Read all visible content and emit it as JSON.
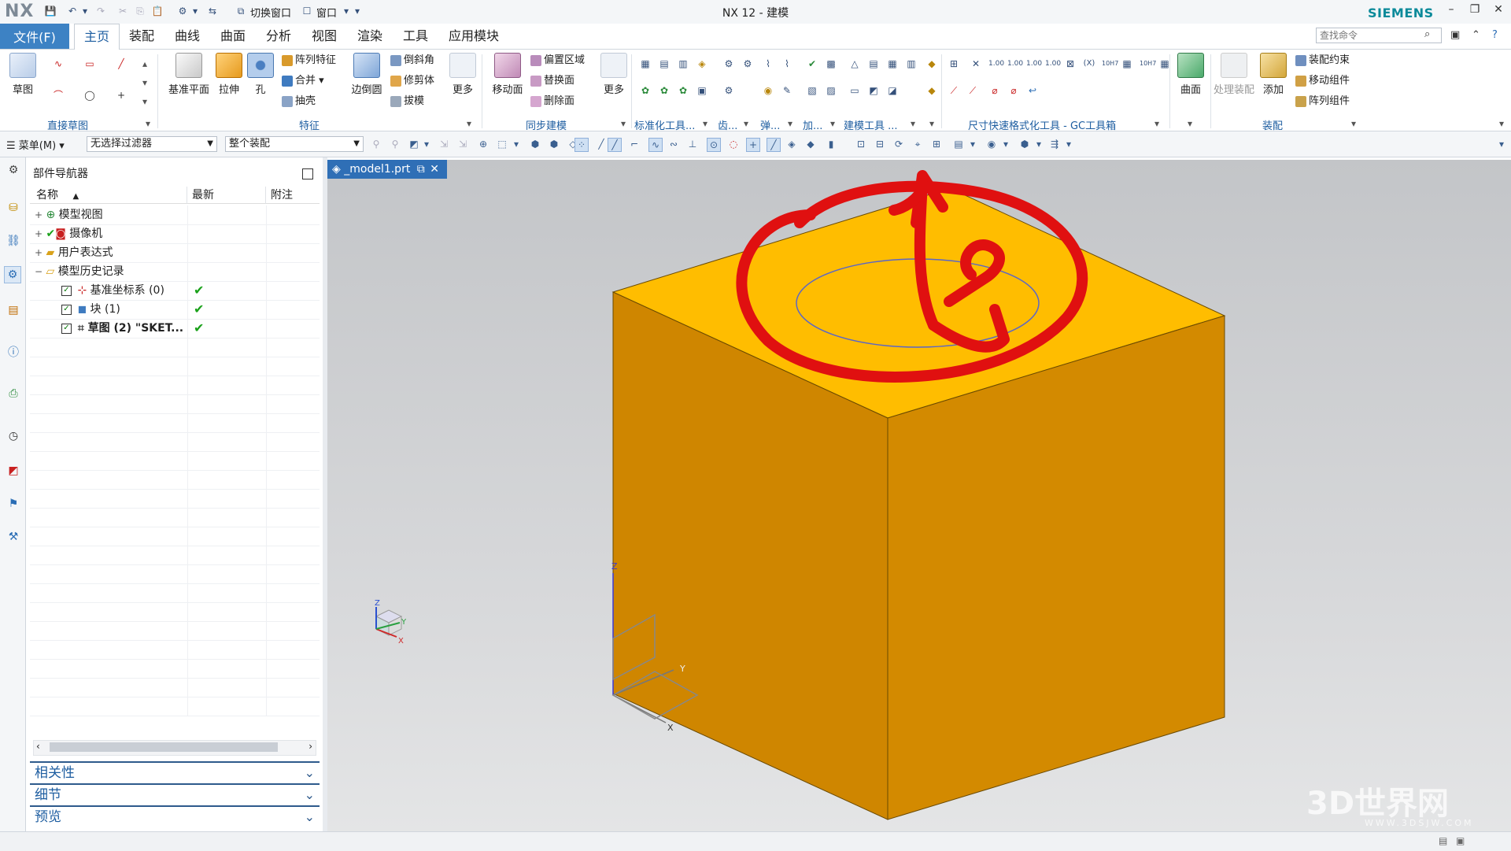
{
  "titlebar": {
    "logo": "NX",
    "switch_window": "切换窗口",
    "window_menu": "窗口",
    "title": "NX 12 - 建模",
    "brand": "SIEMENS"
  },
  "tabs": {
    "file": "文件(F)",
    "items": [
      "主页",
      "装配",
      "曲线",
      "曲面",
      "分析",
      "视图",
      "渲染",
      "工具",
      "应用模块"
    ],
    "active": "主页",
    "search_placeholder": "查找命令"
  },
  "ribbon": {
    "sketch": "草图",
    "datum_plane": "基准平面",
    "extrude": "拉伸",
    "hole": "孔",
    "pattern_feature": "阵列特征",
    "unite": "合并",
    "shell": "抽壳",
    "edge_blend": "边倒圆",
    "chamfer": "倒斜角",
    "trim_body": "修剪体",
    "draft": "拔模",
    "more1": "更多",
    "move_face": "移动面",
    "offset_region": "偏置区域",
    "replace_face": "替换面",
    "delete_face": "删除面",
    "more2": "更多",
    "surface": "曲面",
    "process_assembly": "处理装配",
    "add": "添加",
    "assembly_constraints": "装配约束",
    "move_component": "移动组件",
    "pattern_component": "阵列组件",
    "groups": {
      "direct_sketch": "直接草图",
      "feature": "特征",
      "sync_modeling": "同步建模",
      "std_tools": "标准化工具...",
      "gear": "齿...",
      "spring": "弹...",
      "add_ins": "加...",
      "modeling_tools": "建模工具 ...",
      "gc_toolbox": "尺寸快速格式化工具 - GC工具箱",
      "assembly": "装配"
    }
  },
  "selection_bar": {
    "menu": "菜单(M)",
    "filter": "无选择过滤器",
    "scope": "整个装配"
  },
  "navigator": {
    "title": "部件导航器",
    "columns": [
      "名称",
      "最新",
      "附注"
    ],
    "tree": [
      {
        "label": "模型视图",
        "level": 0,
        "expander": "+",
        "latest": ""
      },
      {
        "label": "摄像机",
        "level": 0,
        "expander": "+",
        "latest": ""
      },
      {
        "label": "用户表达式",
        "level": 0,
        "expander": "+",
        "latest": ""
      },
      {
        "label": "模型历史记录",
        "level": 0,
        "expander": "−",
        "latest": ""
      },
      {
        "label": "基准坐标系 (0)",
        "level": 1,
        "expander": "",
        "latest": "✔"
      },
      {
        "label": "块 (1)",
        "level": 1,
        "expander": "",
        "latest": "✔"
      },
      {
        "label": "草图 (2) \"SKET...",
        "level": 1,
        "expander": "",
        "latest": "✔"
      }
    ],
    "panels": [
      "相关性",
      "细节",
      "预览"
    ]
  },
  "graphics": {
    "tab_label": "_model1.prt",
    "triad_labels": {
      "x": "X",
      "y": "Y",
      "z": "Z"
    },
    "colors": {
      "cube_top": "#ffbd00",
      "cube_front": "#cf8600",
      "cube_right": "#d38a00",
      "annotation": "#e01010",
      "sketch_circle": "#5a66c8"
    }
  },
  "watermark": {
    "text": "3D世界网",
    "sub": "WWW.3DSJW.COM"
  }
}
